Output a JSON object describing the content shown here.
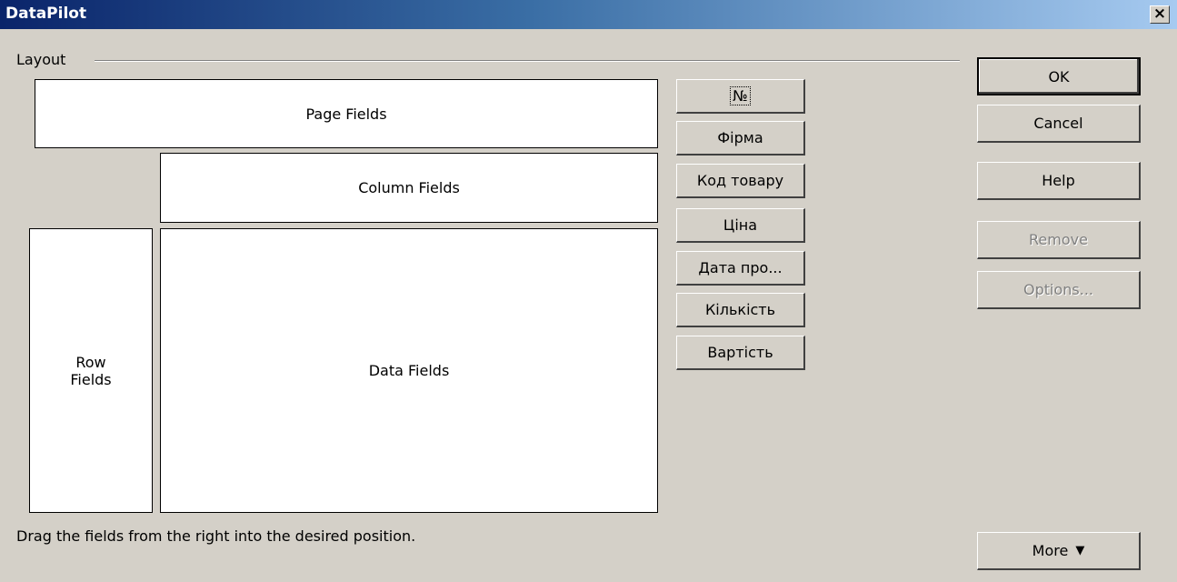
{
  "window": {
    "title": "DataPilot",
    "close_glyph": "✕"
  },
  "layout": {
    "section_label": "Layout",
    "page_fields": "Page Fields",
    "column_fields": "Column Fields",
    "row_fields_line1": "Row",
    "row_fields_line2": "Fields",
    "data_fields": "Data Fields"
  },
  "fields": [
    "№",
    "Фірма",
    "Код товару",
    "Ціна",
    "Дата про...",
    "Кількість",
    "Вартість"
  ],
  "buttons": {
    "ok": "OK",
    "cancel": "Cancel",
    "help": "Help",
    "remove": "Remove",
    "options": "Options...",
    "more": "More"
  },
  "hint": "Drag the fields from the right into the desired position."
}
